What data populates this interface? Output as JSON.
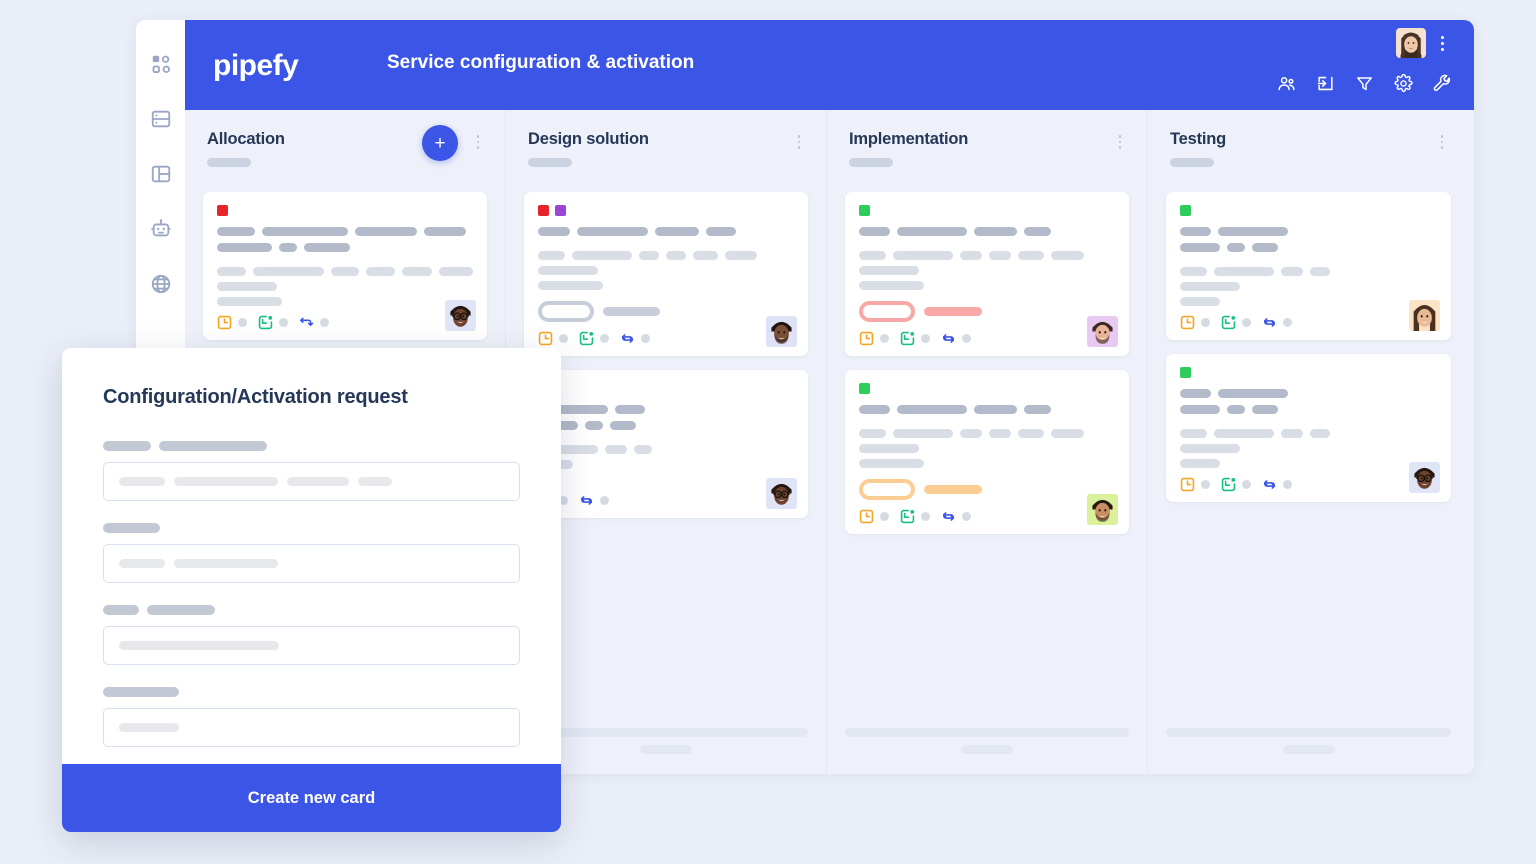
{
  "app": {
    "brand": "pipefy",
    "board_title": "Service configuration & activation",
    "accent": "#3b55e6",
    "board_bg": "#eef1f9",
    "page_bg": "#eaeef7"
  },
  "sidebar": {
    "items": [
      {
        "icon": "grid-dashboard-icon",
        "name": "sidebar-item-dashboard"
      },
      {
        "icon": "database-icon",
        "name": "sidebar-item-database"
      },
      {
        "icon": "layout-template-icon",
        "name": "sidebar-item-templates"
      },
      {
        "icon": "robot-automation-icon",
        "name": "sidebar-item-automations"
      },
      {
        "icon": "globe-icon",
        "name": "sidebar-item-portal"
      }
    ]
  },
  "topbar": {
    "avatar_alt": "user-avatar",
    "menu_label": "more-options",
    "tools": [
      {
        "icon": "members-icon",
        "label": "Members"
      },
      {
        "icon": "inbox-import-icon",
        "label": "Import"
      },
      {
        "icon": "filter-funnel-icon",
        "label": "Filter"
      },
      {
        "icon": "gear-settings-icon",
        "label": "Settings"
      },
      {
        "icon": "wrench-icon",
        "label": "Tools"
      }
    ]
  },
  "board": {
    "add_card_label": "+",
    "columns": [
      {
        "title": "Allocation",
        "has_add_button": true,
        "cards": [
          {
            "labels": [
              "#e5252a"
            ],
            "title_lines": [
              [
                38,
                86,
                62,
                42
              ],
              [
                55,
                18,
                46
              ]
            ],
            "body_lines": [
              [
                31,
                75,
                30,
                31,
                32,
                36
              ],
              [
                60
              ],
              [
                65
              ]
            ],
            "badge": null,
            "avatar": "avatar-glasses-man",
            "footer_icons": [
              "clock-orange-icon",
              "calendar-green-icon",
              "arrow-blue-icon"
            ]
          }
        ]
      },
      {
        "title": "Design solution",
        "has_add_button": false,
        "cards": [
          {
            "labels": [
              "#e5252a",
              "#9b45d6"
            ],
            "title_lines": [
              [
                32,
                71,
                44,
                30
              ],
              []
            ],
            "body_lines": [
              [
                27,
                60,
                20,
                20,
                25,
                32
              ],
              [
                60
              ],
              [
                65
              ]
            ],
            "badge": {
              "outline": "#c7ced9",
              "fill": "#c7ced9",
              "outline_w": 56,
              "fill_w": 57
            },
            "avatar": "avatar-beard-man",
            "footer_icons": [
              "clock-orange-icon",
              "calendar-green-icon",
              "refresh-blue-icon"
            ]
          },
          {
            "labels": [],
            "title_lines": [
              [
                70,
                30
              ],
              [
                40,
                18,
                26
              ]
            ],
            "body_lines": [
              [
                60,
                22,
                18
              ],
              [
                35
              ],
              [
                14
              ]
            ],
            "badge": null,
            "avatar": "avatar-glasses-woman",
            "footer_icons": [
              "calendar-green-icon",
              "refresh-blue-icon"
            ]
          }
        ]
      },
      {
        "title": "Implementation",
        "has_add_button": false,
        "cards": [
          {
            "labels": [
              "#2ecc5a"
            ],
            "title_lines": [
              [
                31,
                70,
                43,
                27
              ]
            ],
            "body_lines": [
              [
                27,
                60,
                22,
                22,
                26,
                33
              ],
              [
                60
              ],
              [
                65
              ]
            ],
            "badge": {
              "outline": "#f9a8a8",
              "fill": "#f9a8a8",
              "outline_w": 56,
              "fill_w": 58
            },
            "avatar": "avatar-pink-man",
            "footer_icons": [
              "clock-orange-icon",
              "calendar-green-icon",
              "refresh-blue-icon"
            ]
          },
          {
            "labels": [
              "#2ecc5a"
            ],
            "title_lines": [
              [
                31,
                70,
                43,
                27
              ]
            ],
            "body_lines": [
              [
                27,
                60,
                22,
                22,
                26,
                33
              ],
              [
                60
              ],
              [
                65
              ]
            ],
            "badge": {
              "outline": "#fbcd92",
              "fill": "#fbcd92",
              "outline_w": 56,
              "fill_w": 58
            },
            "avatar": "avatar-green-man",
            "footer_icons": [
              "clock-orange-icon",
              "calendar-green-icon",
              "refresh-blue-icon"
            ]
          }
        ]
      },
      {
        "title": "Testing",
        "has_add_button": false,
        "cards": [
          {
            "labels": [
              "#2ecc5a"
            ],
            "title_lines": [
              [
                31,
                70
              ],
              [
                40,
                18,
                26
              ]
            ],
            "body_lines": [
              [
                27,
                60,
                22,
                20
              ],
              [
                60
              ],
              [
                40
              ]
            ],
            "badge": null,
            "avatar": "avatar-brown-woman",
            "footer_icons": [
              "clock-orange-icon",
              "calendar-green-icon",
              "refresh-blue-icon"
            ]
          },
          {
            "labels": [
              "#2ecc5a"
            ],
            "title_lines": [
              [
                31,
                70
              ],
              [
                40,
                18,
                26
              ]
            ],
            "body_lines": [
              [
                27,
                60,
                22,
                20
              ],
              [
                60
              ],
              [
                40
              ]
            ],
            "badge": null,
            "avatar": "avatar-glasses-woman-2",
            "footer_icons": [
              "clock-orange-icon",
              "calendar-green-icon",
              "refresh-blue-icon"
            ]
          }
        ]
      }
    ]
  },
  "modal": {
    "title": "Configuration/Activation request",
    "submit_label": "Create new card",
    "fields": [
      {
        "name": "field-1",
        "label_pills": [
          48,
          108
        ],
        "value_pills": [
          46,
          104,
          62,
          34
        ]
      },
      {
        "name": "field-2",
        "label_pills": [
          57
        ],
        "value_pills": [
          46,
          104
        ]
      },
      {
        "name": "field-3",
        "label_pills": [
          36,
          68
        ],
        "value_pills": [
          160
        ]
      },
      {
        "name": "field-4",
        "label_pills": [
          76
        ],
        "value_pills": [
          60
        ]
      }
    ]
  }
}
